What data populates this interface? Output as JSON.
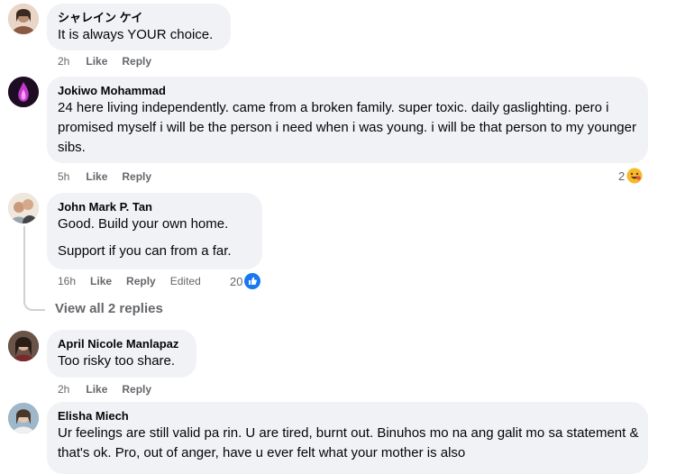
{
  "comments": [
    {
      "author": "シャレイン ケイ",
      "text": [
        "It is always YOUR choice."
      ],
      "time": "2h",
      "like": "Like",
      "reply": "Reply",
      "avatar_color": "#c9a48a"
    },
    {
      "author": "Jokiwo Mohammad",
      "text": [
        "24 here living independently. came from a broken family. super toxic. daily gaslighting. pero i promised myself i will be the person i need when i was young. i will be that person to my younger sibs."
      ],
      "time": "5h",
      "like": "Like",
      "reply": "Reply",
      "reaction_count": "2",
      "avatar_color": "#3a1a3f"
    },
    {
      "author": "John Mark P. Tan",
      "text": [
        "Good. Build your own home.",
        "Support if you can from a far."
      ],
      "time": "16h",
      "like": "Like",
      "reply": "Reply",
      "edited": "Edited",
      "reaction_count": "20",
      "avatar_color": "#d8c7b4",
      "view_replies": "View all 2 replies"
    },
    {
      "author": "April Nicole Manlapaz",
      "text": [
        "Too risky too share."
      ],
      "time": "2h",
      "like": "Like",
      "reply": "Reply",
      "avatar_color": "#4a3a33"
    },
    {
      "author": "Elisha Miech",
      "text": [
        "Ur feelings are still valid pa rin. U are tired, burnt out. Binuhos mo na ang galit mo sa statement & that's ok. Pro, out of anger, have u ever felt what your mother is also"
      ],
      "avatar_color": "#6b8fa8"
    }
  ],
  "colors": {
    "bubble": "#f0f2f5",
    "meta_text": "#65676b",
    "like_blue": "#1877f2",
    "haha_yellow": "#f7b928"
  },
  "icons": {
    "haha_reaction": "haha-emoji-icon",
    "like_reaction": "like-thumb-icon"
  }
}
